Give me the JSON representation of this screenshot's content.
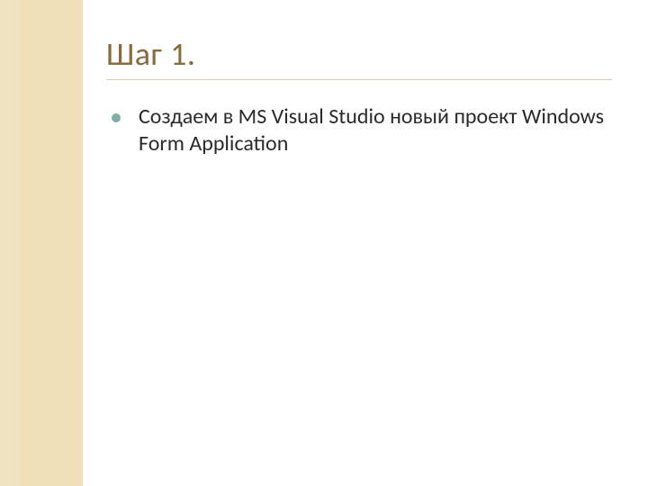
{
  "colors": {
    "accent_title": "#8a6b3e",
    "bullet": "#7fb0a8",
    "sidebar_outer": "#f0e3c2",
    "sidebar_inner": "#efe0ba"
  },
  "title": "Шаг 1.",
  "bullets": [
    {
      "text": "Создаем в MS Visual Studio новый проект Windows Form Application"
    }
  ]
}
